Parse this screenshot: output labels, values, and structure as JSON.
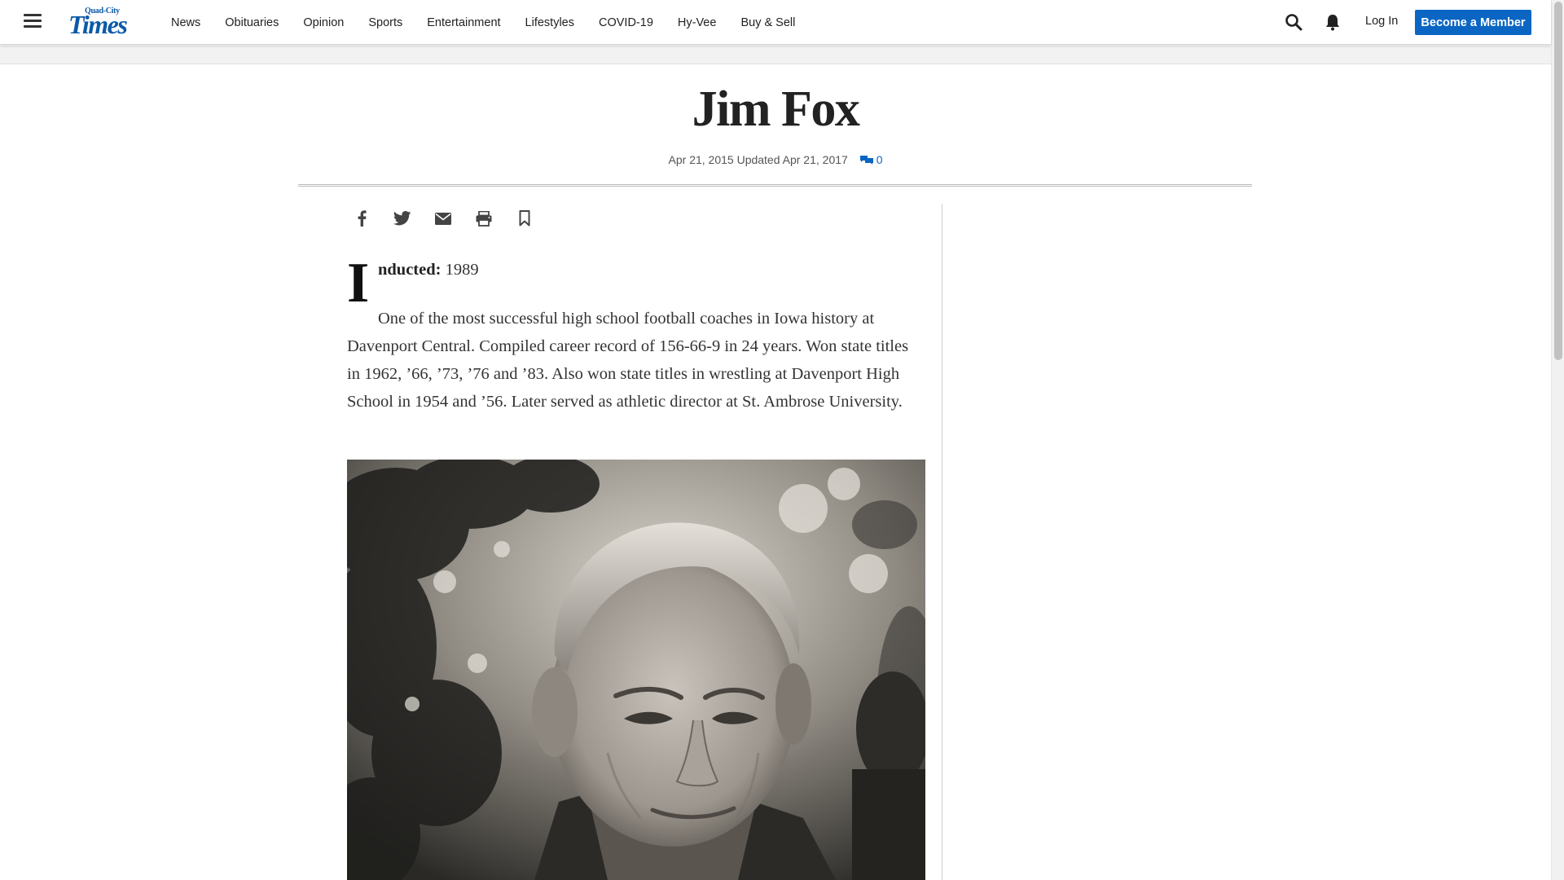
{
  "header": {
    "logo_small": "Quad-City",
    "logo_big": "Times",
    "nav": [
      "News",
      "Obituaries",
      "Opinion",
      "Sports",
      "Entertainment",
      "Lifestyles",
      "COVID-19",
      "Hy-Vee",
      "Buy & Sell"
    ],
    "login_label": "Log In",
    "member_label": "Become a Member"
  },
  "article": {
    "title": "Jim Fox",
    "meta": "Apr 21, 2015 Updated Apr 21, 2017",
    "comments_count": "0",
    "dropcap": "I",
    "inducted_label": "nducted:",
    "inducted_year": " 1989",
    "body": "One of the most successful high school football coaches in Iowa history at Davenport Central. Compiled career record of 156-66-9 in 24 years. Won state titles in 1962, ’66, ’73, ’76 and ’83. Also won state titles in wrestling at Davenport High School in 1954 and ’56. Later served as athletic director at St. Ambrose University."
  },
  "share_icons": [
    "facebook-icon",
    "twitter-icon",
    "email-icon",
    "print-icon",
    "bookmark-icon"
  ],
  "colors": {
    "brand": "#0b5aa8",
    "button": "#0b66c3"
  }
}
